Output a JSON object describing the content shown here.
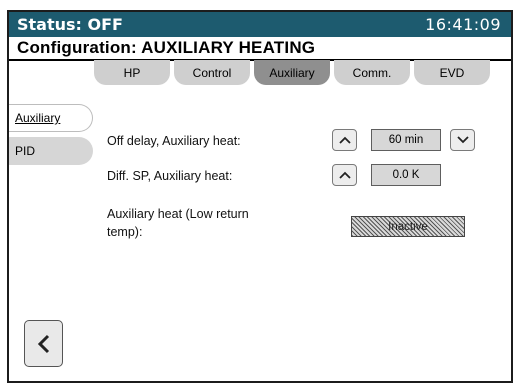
{
  "status": {
    "label": "Status: OFF",
    "time": "16:41:09"
  },
  "title": "Configuration: AUXILIARY HEATING",
  "tabs": [
    {
      "label": "HP",
      "active": false
    },
    {
      "label": "Control",
      "active": false
    },
    {
      "label": "Auxiliary",
      "active": true
    },
    {
      "label": "Comm.",
      "active": false
    },
    {
      "label": "EVD",
      "active": false
    }
  ],
  "sidebar": [
    {
      "label": "Auxiliary",
      "active": true
    },
    {
      "label": "PID",
      "active": false
    }
  ],
  "params": {
    "off_delay": {
      "label": "Off delay, Auxiliary heat:",
      "value": "60 min"
    },
    "diff_sp": {
      "label": "Diff. SP, Auxiliary heat:",
      "value": "0.0 K"
    },
    "low_return": {
      "label_line1": "Auxiliary heat (Low return",
      "label_line2": "temp):",
      "value": "Inactive"
    }
  },
  "colors": {
    "status_bar": "#1d5b6f",
    "tab": "#cfcfcf",
    "tab_active": "#8f8f8f"
  },
  "icons": {
    "up": "chevron-up-icon",
    "down": "chevron-down-icon",
    "back": "chevron-left-icon"
  }
}
